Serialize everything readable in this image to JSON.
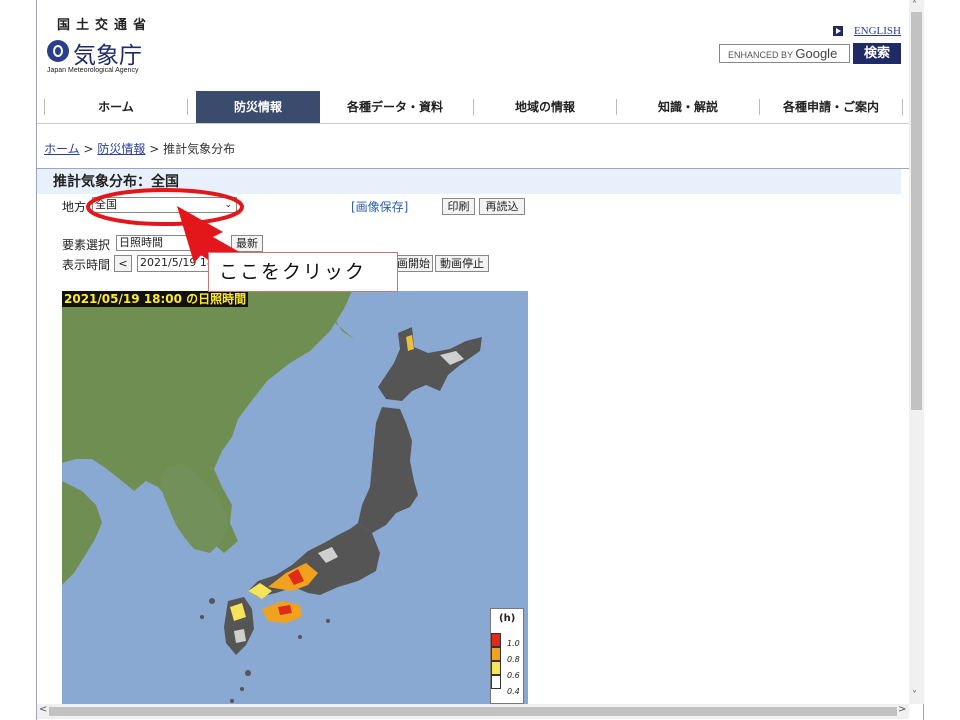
{
  "header": {
    "ministry": "国土交通省",
    "agency_name": "気象庁",
    "agency_en": "Japan Meteorological Agency",
    "english_link": "ENGLISH",
    "search_prefix": "ENHANCED BY",
    "search_brand": "Google",
    "search_button": "検索"
  },
  "nav": {
    "items": [
      {
        "label": "ホーム"
      },
      {
        "label": "防災情報"
      },
      {
        "label": "各種データ・資料"
      },
      {
        "label": "地域の情報"
      },
      {
        "label": "知識・解説"
      },
      {
        "label": "各種申請・ご案内"
      }
    ],
    "active": "防災情報"
  },
  "breadcrumb": {
    "home": "ホーム",
    "sep1": ">",
    "section": "防災情報",
    "sep2": ">",
    "current": "推計気象分布"
  },
  "page": {
    "title": "推計気象分布：全国",
    "region_label": "地方",
    "region_value": "全国",
    "save_link": "[画像保存]",
    "print_button": "印刷",
    "reload_button": "再読込",
    "element_label": "要素選択",
    "element_value": "日照時間",
    "latest_button": "最新",
    "time_label": "表示時間",
    "prev_button": "<",
    "time_value": "2021/5/19 18",
    "play_button_partial": "画開始",
    "stop_button": "動画停止"
  },
  "map": {
    "overlay_title": "2021/05/19 18:00 の日照時間",
    "legend_unit": "(h)",
    "legend_values": [
      "1.0",
      "0.8",
      "0.6",
      "0.4"
    ],
    "legend_colors": [
      "#e02a1a",
      "#f0a21e",
      "#f5e35a",
      "#ffffff"
    ]
  },
  "annotation": {
    "callout_text": "ここをクリック",
    "highlight_color": "#e3171b"
  },
  "colors": {
    "nav_active_bg": "#3a4b6e",
    "brand_navy": "#1f2a66",
    "sea": "#89a9d3",
    "land": "#6f8f52",
    "japan_dark": "#555555"
  }
}
